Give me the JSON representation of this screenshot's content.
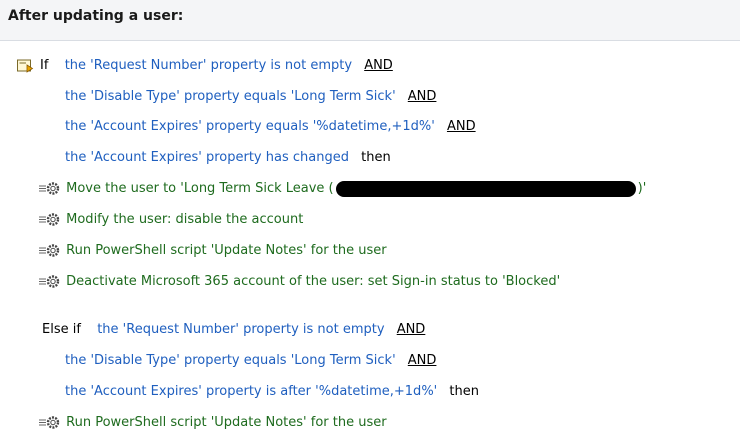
{
  "header": {
    "title": "After updating a user:"
  },
  "rule1": {
    "if_keyword": "If",
    "conditions": [
      {
        "text": "the 'Request  Number' property is not empty",
        "connector": "AND"
      },
      {
        "text": "the 'Disable Type' property equals 'Long Term Sick'",
        "connector": "AND"
      },
      {
        "text": "the 'Account Expires' property equals '%datetime,+1d%'",
        "connector": "AND"
      },
      {
        "text": "the 'Account Expires' property has changed",
        "connector": "then"
      }
    ],
    "actions": [
      {
        "text_before": "Move the user to 'Long Term Sick Leave (",
        "text_after": ")'"
      },
      {
        "text": "Modify the user: disable the account"
      },
      {
        "text": "Run PowerShell script 'Update Notes' for the user"
      },
      {
        "text": "Deactivate Microsoft 365 account of the user: set Sign-in status to 'Blocked'"
      }
    ]
  },
  "rule2": {
    "else_if_keyword": "Else if",
    "conditions": [
      {
        "text": "the 'Request  Number' property is not empty",
        "connector": "AND"
      },
      {
        "text": "the 'Disable Type' property equals 'Long Term Sick'",
        "connector": "AND"
      },
      {
        "text": "the 'Account Expires' property is after '%datetime,+1d%'",
        "connector": "then"
      }
    ],
    "actions": [
      {
        "text": "Run PowerShell script 'Update Notes' for the user"
      }
    ]
  },
  "colors": {
    "condition": "#1f5fbf",
    "action": "#1e6b1e",
    "redaction": "#000000"
  },
  "icons": {
    "condition": "condition-icon",
    "action": "action-gear-icon"
  }
}
